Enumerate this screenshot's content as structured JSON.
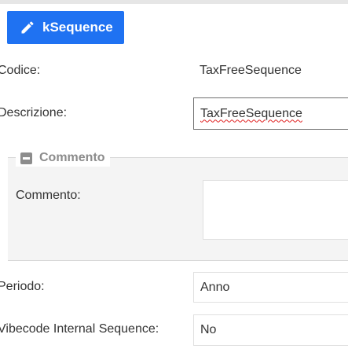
{
  "toolbar": {
    "action_label": "kSequence",
    "action_icon": "pencil-icon"
  },
  "form": {
    "codice_label": "Codice:",
    "codice_value": "TaxFreeSequence",
    "descrizione_label": "Descrizione:",
    "descrizione_value": "TaxFreeSequence",
    "commento_section": "Commento",
    "commento_label": "Commento:",
    "commento_value": "",
    "periodo_label": "Periodo:",
    "periodo_value": "Anno",
    "internal_label": "Vibecode Internal Sequence:",
    "internal_value": "No"
  },
  "colors": {
    "accent": "#1f72f2",
    "panel": "#f4f4f4",
    "legend": "#8c8c8c"
  }
}
